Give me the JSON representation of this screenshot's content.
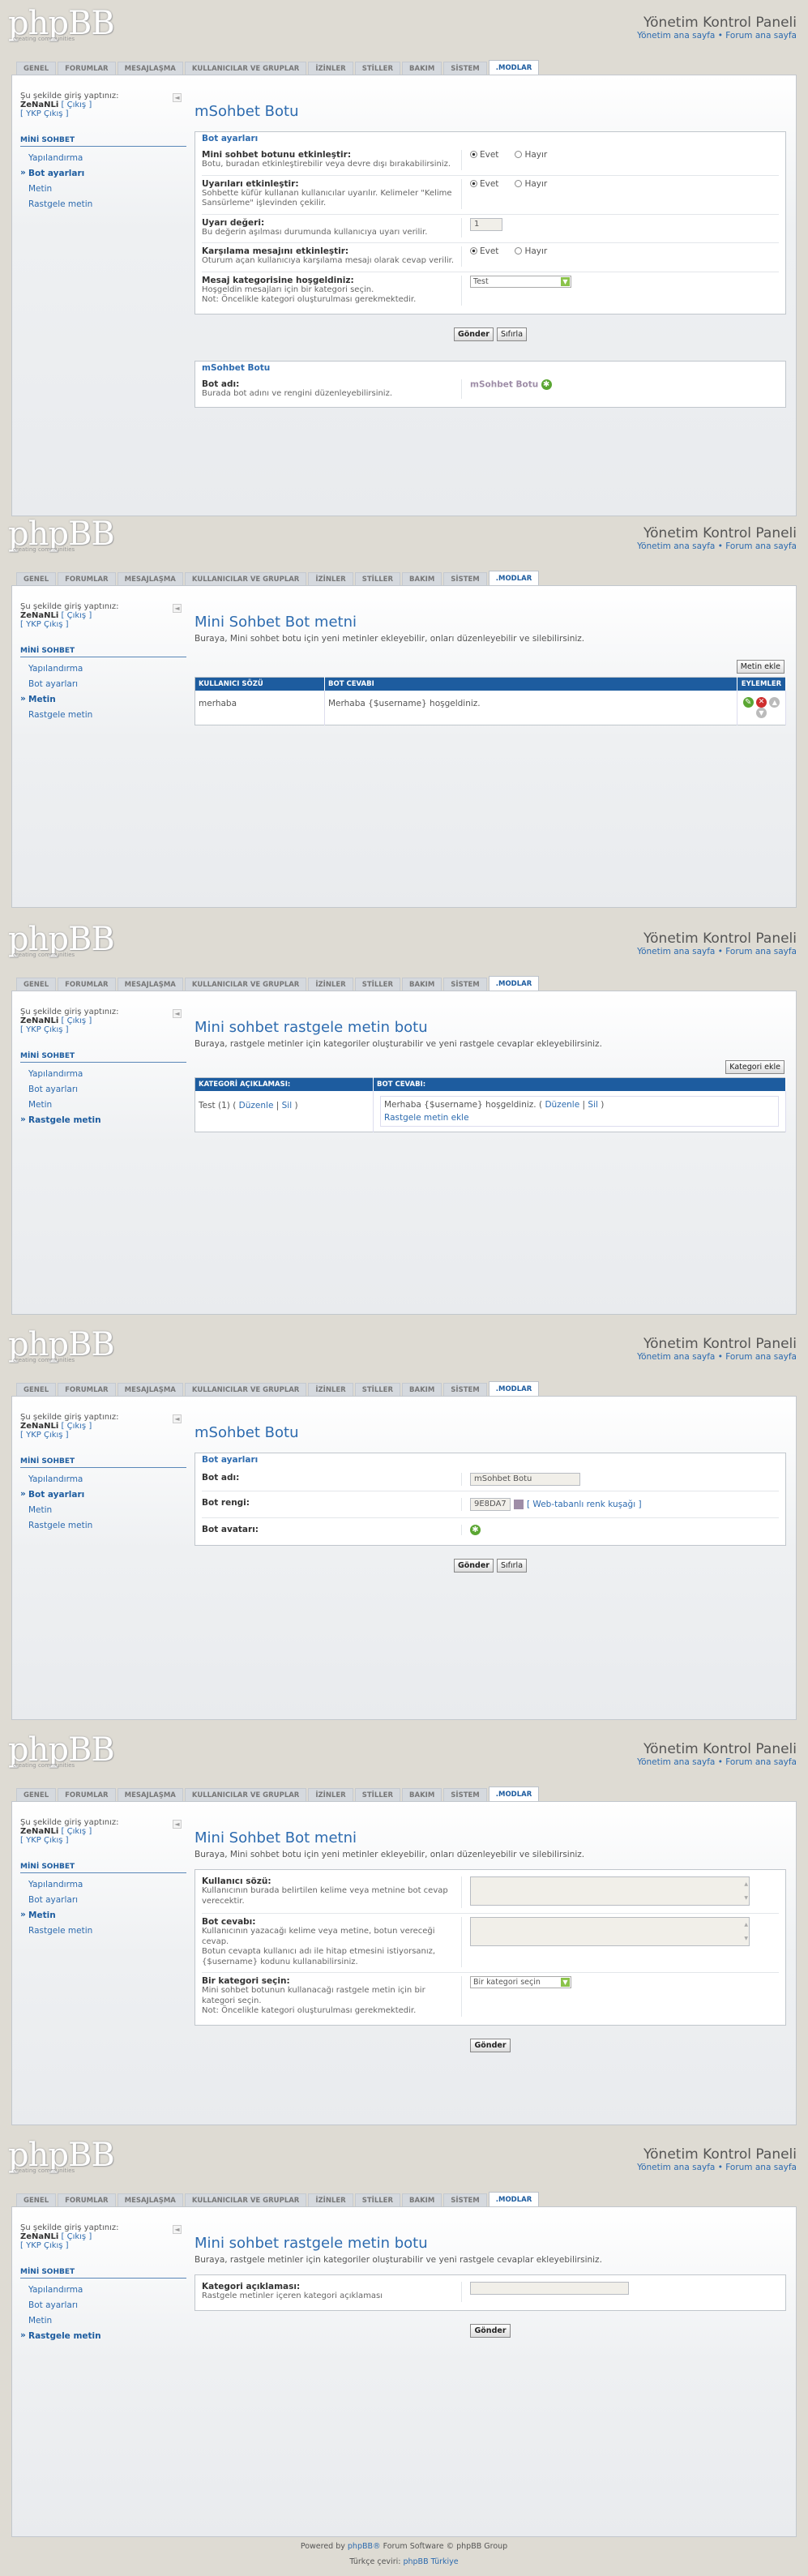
{
  "header": {
    "logo_text": "phpBB",
    "logo_subtext": "creating communities",
    "title_p1": "Yönetim Kontrol Paneli",
    "title_p2": "Yönetim Kontrol Paneli",
    "admin_index": "Yönetim ana sayfa",
    "separator": "•",
    "forum_index": "Forum ana sayfa"
  },
  "tabs": [
    "GENEL",
    "FORUMLAR",
    "MESAJLAŞMA",
    "KULLANICILAR VE GRUPLAR",
    "İZİNLER",
    "STİLLER",
    "BAKIM",
    "SİSTEM",
    ".MODLAR"
  ],
  "sidebar": {
    "logged_in_as": "Şu şekilde giriş yaptınız:",
    "username": "ZeNaNLi",
    "logout": "[ Çıkış ]",
    "ykp_logout": "[ YKP Çıkış ]",
    "collapse_icon": "◄",
    "menu_header": "MİNİ SOHBET",
    "items": [
      "Yapılandırma",
      "Bot ayarları",
      "Metin",
      "Rastgele metin"
    ]
  },
  "panel1": {
    "title": "mSohbet Botu",
    "legend": "Bot ayarları",
    "rows": [
      {
        "label": "Mini sohbet botunu etkinleştir:",
        "desc": "Botu, buradan etkinleştirebilir veya devre dışı bırakabilirsiniz."
      },
      {
        "label": "Uyarıları etkinleştir:",
        "desc": "Sohbette küfür kullanan kullanıcılar uyarılır. Kelimeler \"Kelime Sansürleme\" işlevinden çekilir."
      },
      {
        "label": "Uyarı değeri:",
        "desc": "Bu değerin aşılması durumunda kullanıcıya uyarı verilir."
      },
      {
        "label": "Karşılama mesajını etkinleştir:",
        "desc": "Oturum açan kullanıcıya karşılama mesajı olarak cevap verilir."
      },
      {
        "label": "Mesaj kategorisine hoşgeldiniz:",
        "desc": "Hoşgeldin mesajları için bir kategori seçin.\nNot: Öncelikle kategori oluşturulması gerekmektedir."
      }
    ],
    "yes": "Evet",
    "no": "Hayır",
    "warn_value": "1",
    "category_value": "Test",
    "submit": "Gönder",
    "reset": "Sıfırla",
    "legend2": "mSohbet Botu",
    "bot_name_label": "Bot adı:",
    "bot_name_desc": "Burada bot adını ve rengini düzenleyebilirsiniz.",
    "bot_name_value": "mSohbet Botu"
  },
  "panel2": {
    "title": "Mini Sohbet Bot metni",
    "desc": "Buraya, Mini sohbet botu için yeni metinler ekleyebilir, onları düzenleyebilir ve silebilirsiniz.",
    "add_button": "Metin ekle",
    "columns": [
      "KULLANICI SÖZÜ",
      "BOT CEVABI",
      "EYLEMLER"
    ],
    "row": {
      "user": "merhaba",
      "bot": "Merhaba {$username} hoşgeldiniz."
    }
  },
  "panel3": {
    "title": "Mini sohbet rastgele metin botu",
    "desc": "Buraya, rastgele metinler için kategoriler oluşturabilir ve yeni rastgele cevaplar ekleyebilirsiniz.",
    "add_button": "Kategori ekle",
    "columns": [
      "KATEGORİ AÇIKLAMASI:",
      "BOT CEVABI:"
    ],
    "cat_name": "Test (1)",
    "edit": "Düzenle",
    "delete": "Sil",
    "reply_text": "Merhaba {$username} hoşgeldiniz.",
    "add_reply": "Rastgele metin ekle"
  },
  "panel4": {
    "title": "mSohbet Botu",
    "legend": "Bot ayarları",
    "name_label": "Bot adı:",
    "name_value": "mSohbet Botu",
    "color_label": "Bot rengi:",
    "color_value": "9E8DA7",
    "color_link": "[ Web-tabanlı renk kuşağı ]",
    "avatar_label": "Bot avatarı:",
    "submit": "Gönder",
    "reset": "Sıfırla"
  },
  "panel5": {
    "title": "Mini Sohbet Bot metni",
    "desc": "Buraya, Mini sohbet botu için yeni metinler ekleyebilir, onları düzenleyebilir ve silebilirsiniz.",
    "rows": [
      {
        "label": "Kullanıcı sözü:",
        "desc": "Kullanıcının burada belirtilen kelime veya metnine bot cevap verecektir."
      },
      {
        "label": "Bot cevabı:",
        "desc": "Kullanıcının yazacağı kelime veya metine, botun vereceği cevap.\nBotun cevapta kullanıcı adı ile hitap etmesini istiyorsanız, {$username} kodunu kullanabilirsiniz."
      },
      {
        "label": "Bir kategori seçin:",
        "desc": "Mini sohbet botunun kullanacağı rastgele metin için bir kategori seçin.\nNot: Öncelikle kategori oluşturulması gerekmektedir."
      }
    ],
    "select_value": "Bir kategori seçin",
    "submit": "Gönder"
  },
  "panel6": {
    "title": "Mini sohbet rastgele metin botu",
    "desc": "Buraya, rastgele metinler için kategoriler oluşturabilir ve yeni rastgele cevaplar ekleyebilirsiniz.",
    "label": "Kategori açıklaması:",
    "label_desc": "Rastgele metinler içeren kategori açıklaması",
    "submit": "Gönder"
  },
  "footer": {
    "powered_prefix": "Powered by",
    "powered_link": "phpBB®",
    "powered_suffix": "Forum Software © phpBB Group",
    "translated_prefix": "Türkçe çeviri:",
    "translated_link": "phpBB Türkiye"
  },
  "colors": {
    "accent": "#1d5c9f",
    "link": "#2d6baf",
    "background": "#dedbd3",
    "bot_color": "#9e8da7"
  }
}
